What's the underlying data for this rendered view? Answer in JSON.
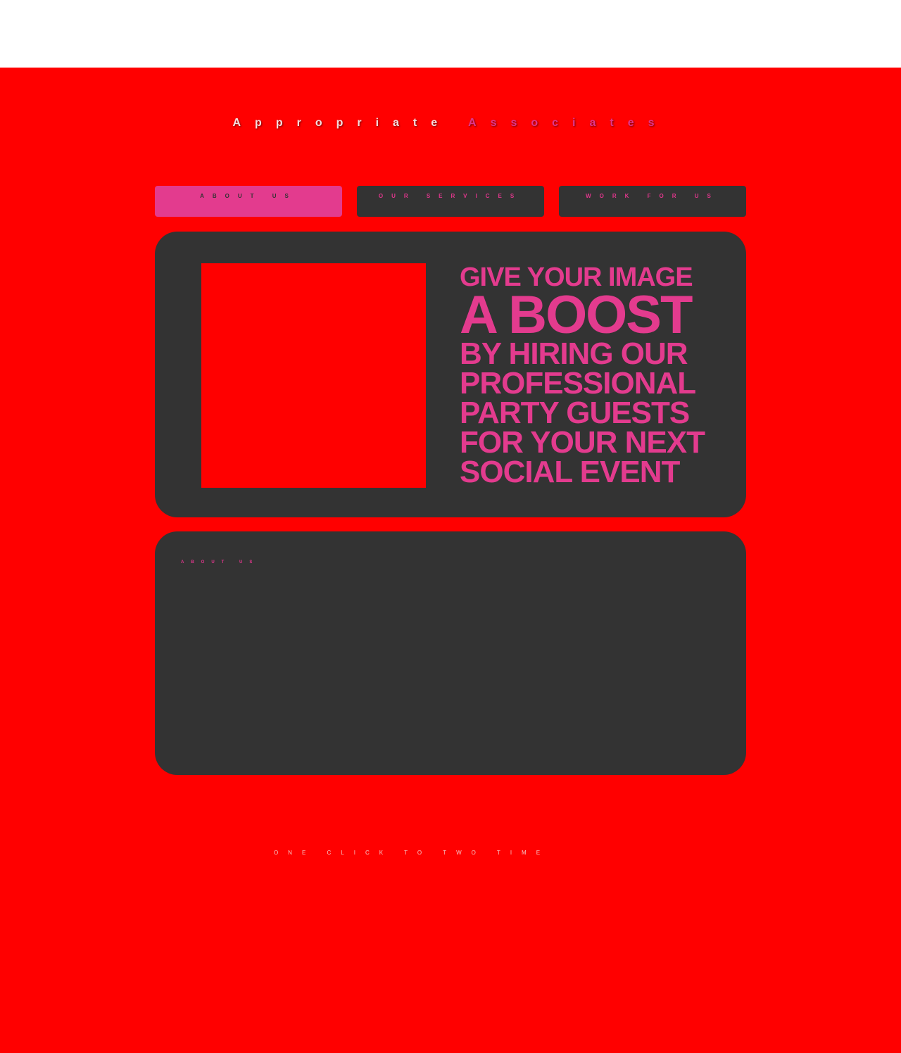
{
  "top_strip": {
    "text": ""
  },
  "header": {
    "title_part1": "Appropriate",
    "title_part2": "Associates"
  },
  "nav": {
    "items": [
      {
        "label": "ABOUT US"
      },
      {
        "label": "OUR SERVICES"
      },
      {
        "label": "WORK FOR US"
      }
    ],
    "active_index": 0
  },
  "hero": {
    "line1": "GIVE YOUR IMAGE",
    "line2": "A BOOST",
    "line3": "BY HIRING OUR",
    "line4": "PROFESSIONAL",
    "line5": "PARTY GUESTS",
    "line6": "FOR YOUR NEXT",
    "line7": "SOCIAL EVENT"
  },
  "about": {
    "heading": "ABOUT US",
    "body": ""
  },
  "footer": {
    "tagline": "ONE CLICK TO TWO TIME"
  },
  "colors": {
    "page_background": "#ff0000",
    "panel": "#333333",
    "accent_pink": "#e33b8e",
    "top_strip": "#ffffff"
  }
}
